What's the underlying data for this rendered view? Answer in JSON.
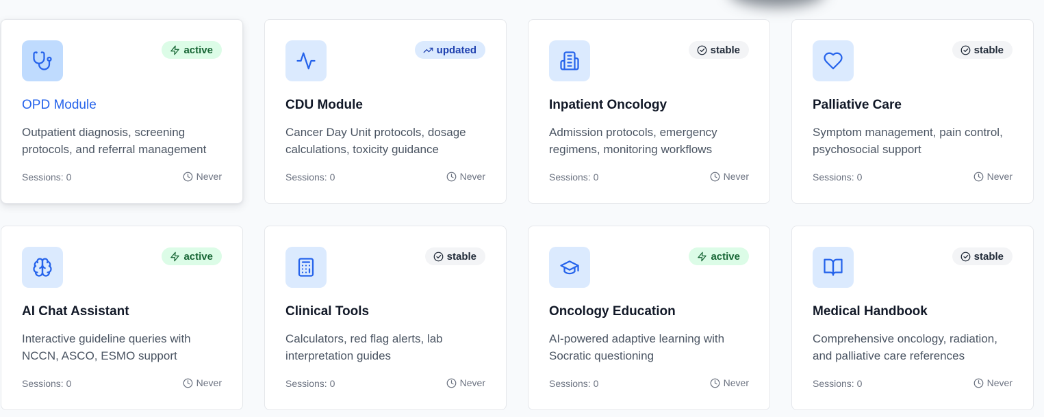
{
  "modules": [
    {
      "title": "OPD Module",
      "description": "Outpatient diagnosis, screening protocols, and referral management",
      "status": "active",
      "sessions": "Sessions: 0",
      "last_used": "Never",
      "icon": "stethoscope-icon"
    },
    {
      "title": "CDU Module",
      "description": "Cancer Day Unit protocols, dosage calculations, toxicity guidance",
      "status": "updated",
      "sessions": "Sessions: 0",
      "last_used": "Never",
      "icon": "activity-icon"
    },
    {
      "title": "Inpatient Oncology",
      "description": "Admission protocols, emergency regimens, monitoring workflows",
      "status": "stable",
      "sessions": "Sessions: 0",
      "last_used": "Never",
      "icon": "hospital-icon"
    },
    {
      "title": "Palliative Care",
      "description": "Symptom management, pain control, psychosocial support",
      "status": "stable",
      "sessions": "Sessions: 0",
      "last_used": "Never",
      "icon": "heart-icon"
    },
    {
      "title": "AI Chat Assistant",
      "description": "Interactive guideline queries with NCCN, ASCO, ESMO support",
      "status": "active",
      "sessions": "Sessions: 0",
      "last_used": "Never",
      "icon": "brain-icon"
    },
    {
      "title": "Clinical Tools",
      "description": "Calculators, red flag alerts, lab interpretation guides",
      "status": "stable",
      "sessions": "Sessions: 0",
      "last_used": "Never",
      "icon": "calculator-icon"
    },
    {
      "title": "Oncology Education",
      "description": "AI-powered adaptive learning with Socratic questioning",
      "status": "active",
      "sessions": "Sessions: 0",
      "last_used": "Never",
      "icon": "graduation-cap-icon"
    },
    {
      "title": "Medical Handbook",
      "description": "Comprehensive oncology, radiation, and palliative care references",
      "status": "stable",
      "sessions": "Sessions: 0",
      "last_used": "Never",
      "icon": "book-open-icon"
    }
  ],
  "colors": {
    "accent": "#2563eb",
    "active_bg": "#dcfce7",
    "active_text": "#166534",
    "updated_bg": "#dbeafe",
    "updated_text": "#1e40af",
    "stable_bg": "#f3f4f6",
    "stable_text": "#1f2937"
  }
}
